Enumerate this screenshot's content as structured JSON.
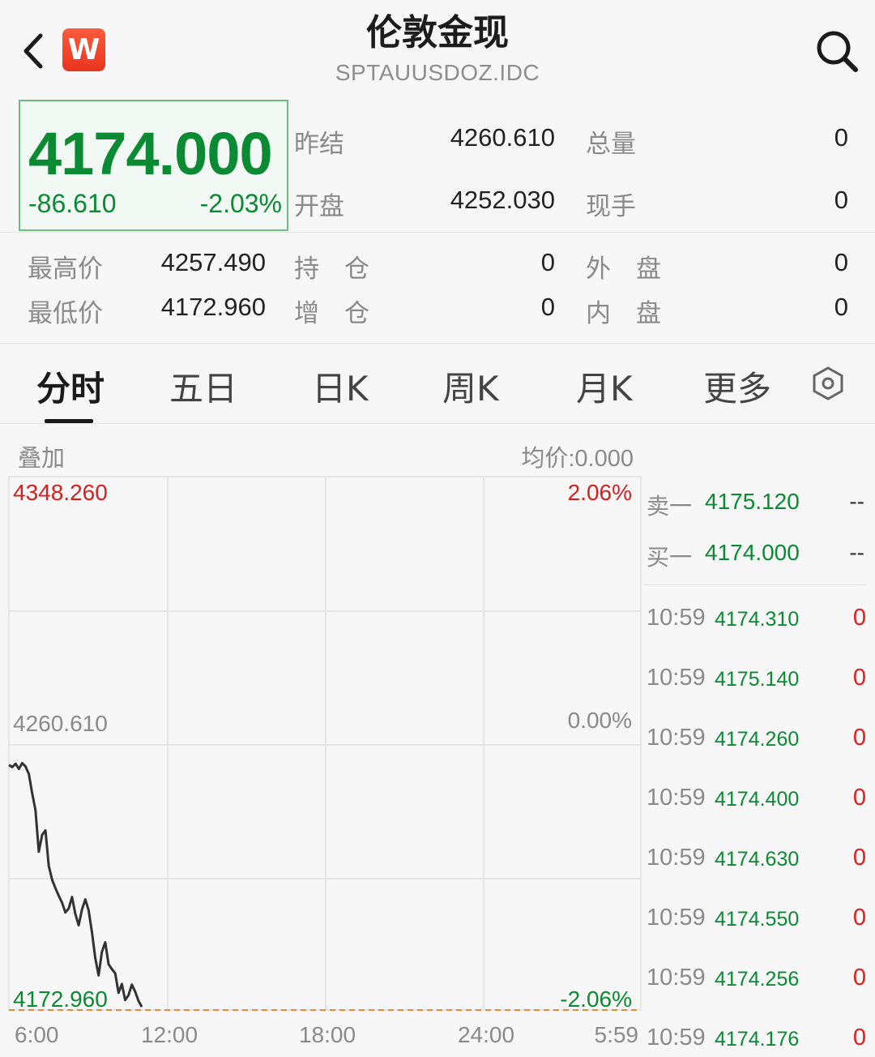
{
  "header": {
    "title": "伦敦金现",
    "subtitle": "SPTAUUSDOZ.IDC",
    "logo_letter": "W"
  },
  "quote": {
    "last_price": "4174.000",
    "change": "-86.610",
    "change_pct": "-2.03%",
    "prev_settle_label": "昨结",
    "prev_settle": "4260.610",
    "open_label": "开盘",
    "open": "4252.030",
    "total_volume_label": "总量",
    "total_volume": "0",
    "current_volume_label": "现手",
    "current_volume": "0",
    "high_label": "最高价",
    "high": "4257.490",
    "low_label": "最低价",
    "low": "4172.960",
    "open_interest_label": "持　仓",
    "open_interest": "0",
    "oi_change_label": "增　仓",
    "oi_change": "0",
    "outer_label": "外　盘",
    "outer": "0",
    "inner_label": "内　盘",
    "inner": "0"
  },
  "tabs": [
    {
      "label": "分时",
      "active": true
    },
    {
      "label": "五日",
      "active": false
    },
    {
      "label": "日K",
      "active": false
    },
    {
      "label": "周K",
      "active": false
    },
    {
      "label": "月K",
      "active": false
    },
    {
      "label": "更多",
      "active": false
    }
  ],
  "chart_header": {
    "overlay_label": "叠加",
    "avg_price": "均价:0.000"
  },
  "chart_data": {
    "type": "line",
    "y_max_label": "4348.260",
    "y_mid_label": "4260.610",
    "y_min_label": "4172.960",
    "pct_max_label": "2.06%",
    "pct_mid_label": "0.00%",
    "pct_min_label": "-2.06%",
    "x_labels": [
      "6:00",
      "12:00",
      "18:00",
      "24:00",
      "5:59"
    ],
    "ylim": [
      4172.96,
      4348.26
    ],
    "prev_close": 4260.61,
    "series": [
      {
        "values": [
          4253.5,
          4252.8,
          4253.9,
          4252.2,
          4254.1,
          4253.0,
          4250.5,
          4244.2,
          4238.6,
          4225.0,
          4230.5,
          4232.0,
          4220.3,
          4215.8,
          4213.0,
          4210.5,
          4208.2,
          4205.0,
          4206.3,
          4210.1,
          4204.5,
          4200.8,
          4206.0,
          4209.3,
          4205.7,
          4198.5,
          4190.0,
          4184.3,
          4192.1,
          4195.2,
          4188.0,
          4186.4,
          4185.0,
          4178.6,
          4181.5,
          4176.2,
          4177.8,
          4181.3,
          4179.0,
          4176.0,
          4174.0
        ]
      }
    ],
    "colors": {
      "line": "#333333",
      "baseline_dash": "#f08a24",
      "up": "#e02020",
      "down": "#0a8a33"
    }
  },
  "order_book": [
    {
      "label": "卖一",
      "price": "4175.120",
      "volume": "--"
    },
    {
      "label": "买一",
      "price": "4174.000",
      "volume": "--"
    }
  ],
  "ticks": [
    {
      "time": "10:59",
      "price": "4174.310",
      "volume": "0"
    },
    {
      "time": "10:59",
      "price": "4175.140",
      "volume": "0"
    },
    {
      "time": "10:59",
      "price": "4174.260",
      "volume": "0"
    },
    {
      "time": "10:59",
      "price": "4174.400",
      "volume": "0"
    },
    {
      "time": "10:59",
      "price": "4174.630",
      "volume": "0"
    },
    {
      "time": "10:59",
      "price": "4174.550",
      "volume": "0"
    },
    {
      "time": "10:59",
      "price": "4174.256",
      "volume": "0"
    },
    {
      "time": "10:59",
      "price": "4174.176",
      "volume": "0"
    }
  ]
}
